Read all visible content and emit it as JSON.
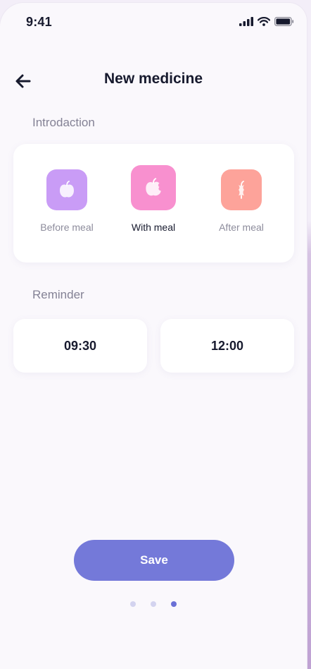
{
  "status_bar": {
    "time": "9:41"
  },
  "header": {
    "title": "New medicine"
  },
  "intake": {
    "section_label": "Introdaction",
    "options": [
      {
        "label": "Before meal",
        "icon": "apple-icon",
        "color": "#c99cf6",
        "selected": false
      },
      {
        "label": "With meal",
        "icon": "bitten-apple-icon",
        "color": "#f890cf",
        "selected": true
      },
      {
        "label": "After meal",
        "icon": "apple-core-icon",
        "color": "#fda39a",
        "selected": false
      }
    ]
  },
  "reminder": {
    "section_label": "Reminder",
    "times": [
      "09:30",
      "12:00"
    ]
  },
  "actions": {
    "save_label": "Save",
    "accent_color": "#7479d9"
  },
  "pagination": {
    "total": 3,
    "current": 3
  }
}
